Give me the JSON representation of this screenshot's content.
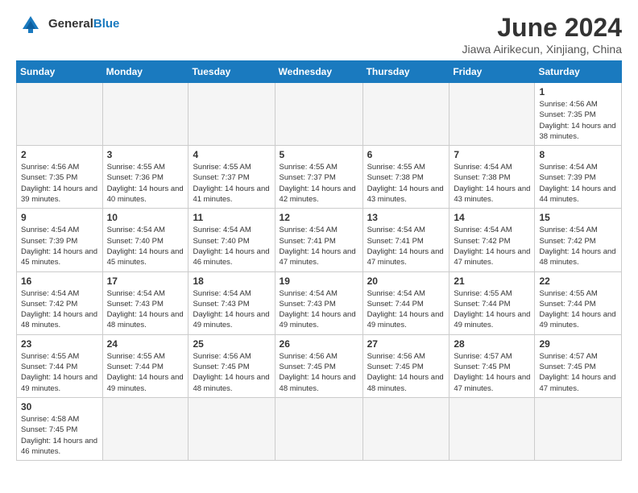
{
  "logo": {
    "text_general": "General",
    "text_blue": "Blue"
  },
  "title": "June 2024",
  "location": "Jiawa Airikecun, Xinjiang, China",
  "weekdays": [
    "Sunday",
    "Monday",
    "Tuesday",
    "Wednesday",
    "Thursday",
    "Friday",
    "Saturday"
  ],
  "weeks": [
    [
      {
        "day": "",
        "info": ""
      },
      {
        "day": "",
        "info": ""
      },
      {
        "day": "",
        "info": ""
      },
      {
        "day": "",
        "info": ""
      },
      {
        "day": "",
        "info": ""
      },
      {
        "day": "",
        "info": ""
      },
      {
        "day": "1",
        "info": "Sunrise: 4:56 AM\nSunset: 7:35 PM\nDaylight: 14 hours and 38 minutes."
      }
    ],
    [
      {
        "day": "2",
        "info": "Sunrise: 4:56 AM\nSunset: 7:35 PM\nDaylight: 14 hours and 39 minutes."
      },
      {
        "day": "3",
        "info": "Sunrise: 4:55 AM\nSunset: 7:36 PM\nDaylight: 14 hours and 40 minutes."
      },
      {
        "day": "4",
        "info": "Sunrise: 4:55 AM\nSunset: 7:37 PM\nDaylight: 14 hours and 41 minutes."
      },
      {
        "day": "5",
        "info": "Sunrise: 4:55 AM\nSunset: 7:37 PM\nDaylight: 14 hours and 42 minutes."
      },
      {
        "day": "6",
        "info": "Sunrise: 4:55 AM\nSunset: 7:38 PM\nDaylight: 14 hours and 43 minutes."
      },
      {
        "day": "7",
        "info": "Sunrise: 4:54 AM\nSunset: 7:38 PM\nDaylight: 14 hours and 43 minutes."
      },
      {
        "day": "8",
        "info": "Sunrise: 4:54 AM\nSunset: 7:39 PM\nDaylight: 14 hours and 44 minutes."
      }
    ],
    [
      {
        "day": "9",
        "info": "Sunrise: 4:54 AM\nSunset: 7:39 PM\nDaylight: 14 hours and 45 minutes."
      },
      {
        "day": "10",
        "info": "Sunrise: 4:54 AM\nSunset: 7:40 PM\nDaylight: 14 hours and 45 minutes."
      },
      {
        "day": "11",
        "info": "Sunrise: 4:54 AM\nSunset: 7:40 PM\nDaylight: 14 hours and 46 minutes."
      },
      {
        "day": "12",
        "info": "Sunrise: 4:54 AM\nSunset: 7:41 PM\nDaylight: 14 hours and 47 minutes."
      },
      {
        "day": "13",
        "info": "Sunrise: 4:54 AM\nSunset: 7:41 PM\nDaylight: 14 hours and 47 minutes."
      },
      {
        "day": "14",
        "info": "Sunrise: 4:54 AM\nSunset: 7:42 PM\nDaylight: 14 hours and 47 minutes."
      },
      {
        "day": "15",
        "info": "Sunrise: 4:54 AM\nSunset: 7:42 PM\nDaylight: 14 hours and 48 minutes."
      }
    ],
    [
      {
        "day": "16",
        "info": "Sunrise: 4:54 AM\nSunset: 7:42 PM\nDaylight: 14 hours and 48 minutes."
      },
      {
        "day": "17",
        "info": "Sunrise: 4:54 AM\nSunset: 7:43 PM\nDaylight: 14 hours and 48 minutes."
      },
      {
        "day": "18",
        "info": "Sunrise: 4:54 AM\nSunset: 7:43 PM\nDaylight: 14 hours and 49 minutes."
      },
      {
        "day": "19",
        "info": "Sunrise: 4:54 AM\nSunset: 7:43 PM\nDaylight: 14 hours and 49 minutes."
      },
      {
        "day": "20",
        "info": "Sunrise: 4:54 AM\nSunset: 7:44 PM\nDaylight: 14 hours and 49 minutes."
      },
      {
        "day": "21",
        "info": "Sunrise: 4:55 AM\nSunset: 7:44 PM\nDaylight: 14 hours and 49 minutes."
      },
      {
        "day": "22",
        "info": "Sunrise: 4:55 AM\nSunset: 7:44 PM\nDaylight: 14 hours and 49 minutes."
      }
    ],
    [
      {
        "day": "23",
        "info": "Sunrise: 4:55 AM\nSunset: 7:44 PM\nDaylight: 14 hours and 49 minutes."
      },
      {
        "day": "24",
        "info": "Sunrise: 4:55 AM\nSunset: 7:44 PM\nDaylight: 14 hours and 49 minutes."
      },
      {
        "day": "25",
        "info": "Sunrise: 4:56 AM\nSunset: 7:45 PM\nDaylight: 14 hours and 48 minutes."
      },
      {
        "day": "26",
        "info": "Sunrise: 4:56 AM\nSunset: 7:45 PM\nDaylight: 14 hours and 48 minutes."
      },
      {
        "day": "27",
        "info": "Sunrise: 4:56 AM\nSunset: 7:45 PM\nDaylight: 14 hours and 48 minutes."
      },
      {
        "day": "28",
        "info": "Sunrise: 4:57 AM\nSunset: 7:45 PM\nDaylight: 14 hours and 47 minutes."
      },
      {
        "day": "29",
        "info": "Sunrise: 4:57 AM\nSunset: 7:45 PM\nDaylight: 14 hours and 47 minutes."
      }
    ],
    [
      {
        "day": "30",
        "info": "Sunrise: 4:58 AM\nSunset: 7:45 PM\nDaylight: 14 hours and 46 minutes."
      },
      {
        "day": "",
        "info": ""
      },
      {
        "day": "",
        "info": ""
      },
      {
        "day": "",
        "info": ""
      },
      {
        "day": "",
        "info": ""
      },
      {
        "day": "",
        "info": ""
      },
      {
        "day": "",
        "info": ""
      }
    ]
  ]
}
